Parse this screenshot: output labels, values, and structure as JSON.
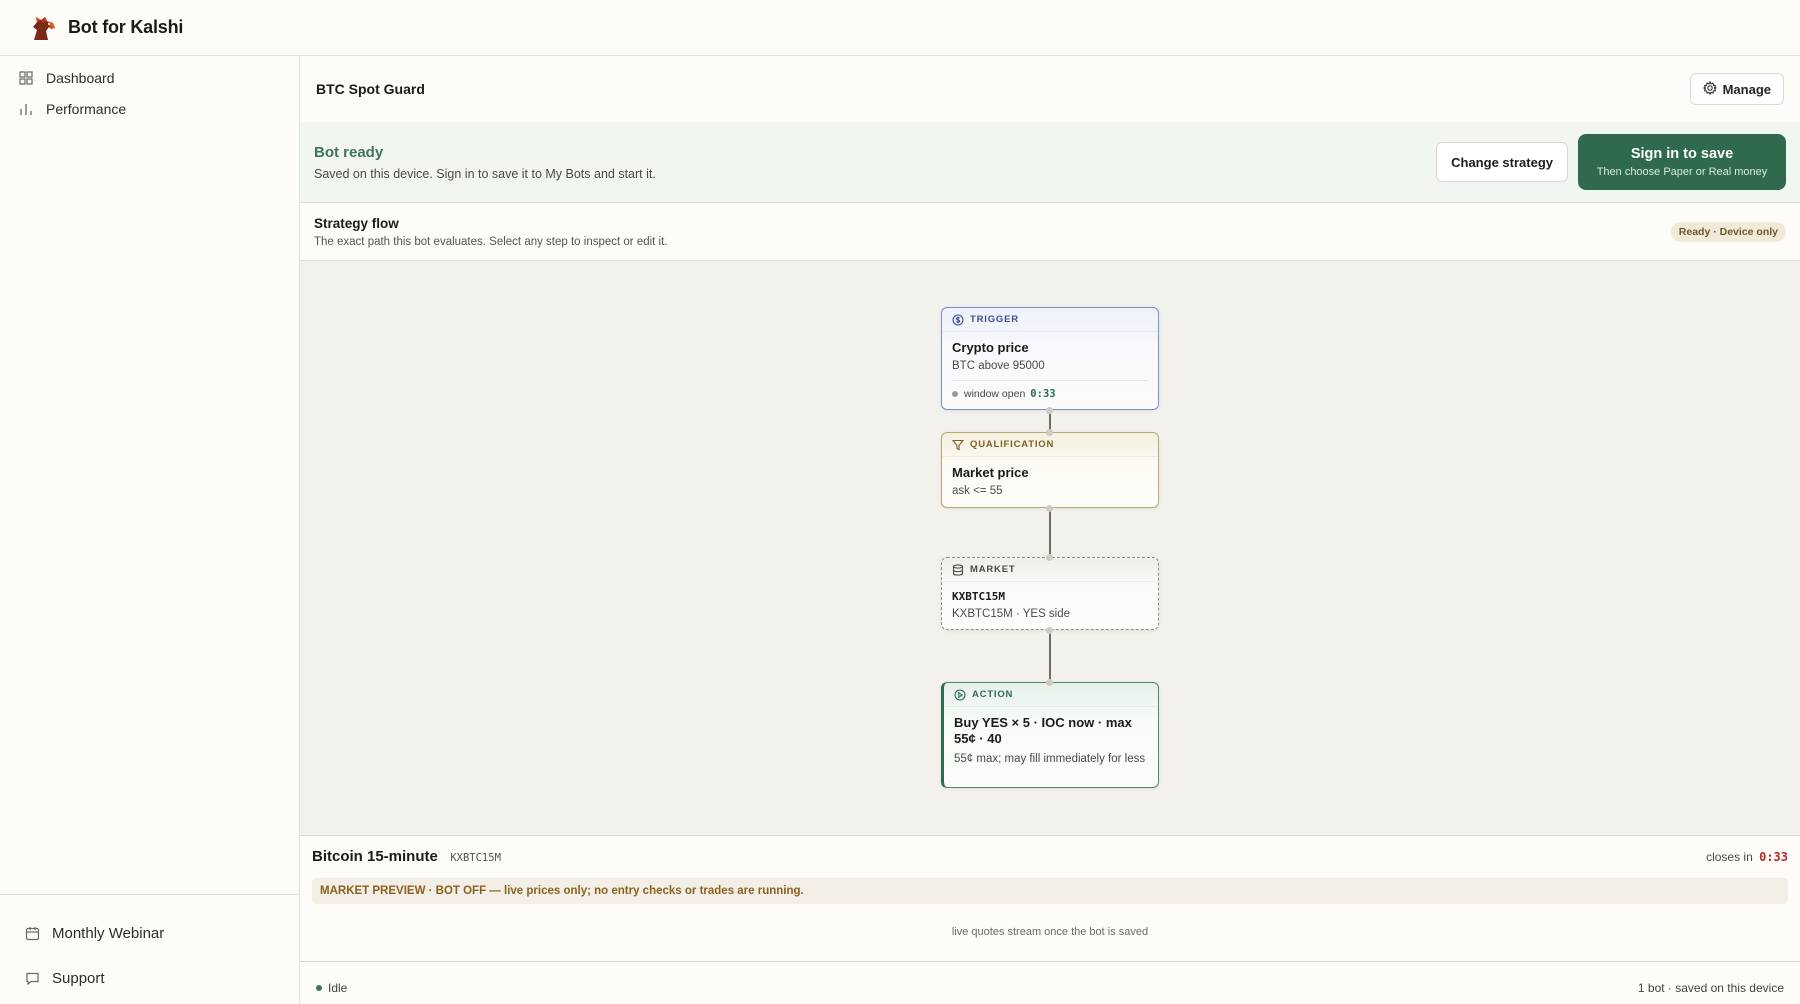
{
  "app": {
    "title": "Bot for Kalshi",
    "logo_icon": "horse-head-logo"
  },
  "sidebar": {
    "items": [
      {
        "label": "Dashboard",
        "icon": "grid-icon"
      },
      {
        "label": "Performance",
        "icon": "bar-chart-icon"
      }
    ],
    "bottom_items": [
      {
        "label": "Monthly Webinar",
        "icon": "calendar-icon"
      },
      {
        "label": "Support",
        "icon": "chat-icon"
      }
    ]
  },
  "header": {
    "bot_name": "BTC Spot Guard",
    "manage_label": "Manage"
  },
  "banner": {
    "title": "Bot ready",
    "subtitle": "Saved on this device. Sign in to save it to My Bots and start it.",
    "change_label": "Change strategy",
    "signin_label": "Sign in to save",
    "signin_sub": "Then choose Paper or Real money"
  },
  "flow": {
    "title": "Strategy flow",
    "subtitle": "The exact path this bot evaluates. Select any step to inspect or edit it.",
    "badge": "Ready · Device only",
    "nodes": {
      "trigger": {
        "kind": "TRIGGER",
        "title": "Crypto price",
        "sub": "BTC above 95000",
        "window_label": "window open",
        "window_time": "0:33"
      },
      "qualification": {
        "kind": "QUALIFICATION",
        "title": "Market price",
        "sub": "ask <= 55"
      },
      "market": {
        "kind": "MARKET",
        "title": "KXBTC15M",
        "sub": "KXBTC15M · YES side"
      },
      "action": {
        "kind": "ACTION",
        "title": "Buy YES × 5 · IOC now · max 55¢ · 40",
        "sub": "55¢ max; may fill immediately for less"
      }
    }
  },
  "market_panel": {
    "title": "Bitcoin 15-minute",
    "ticker": "KXBTC15M",
    "closes_label": "closes in",
    "closes_time": "0:33",
    "preview": "MARKET PREVIEW · BOT OFF — live prices only; no entry checks or trades are running.",
    "note": "live quotes stream once the bot is saved"
  },
  "statusbar": {
    "state": "Idle",
    "summary": "1 bot · saved on this device"
  },
  "colors": {
    "accent": "#2f6a4f",
    "trigger": "#7b8fcf",
    "qualification": "#b9a878",
    "countdown_red": "#b42b2b"
  }
}
